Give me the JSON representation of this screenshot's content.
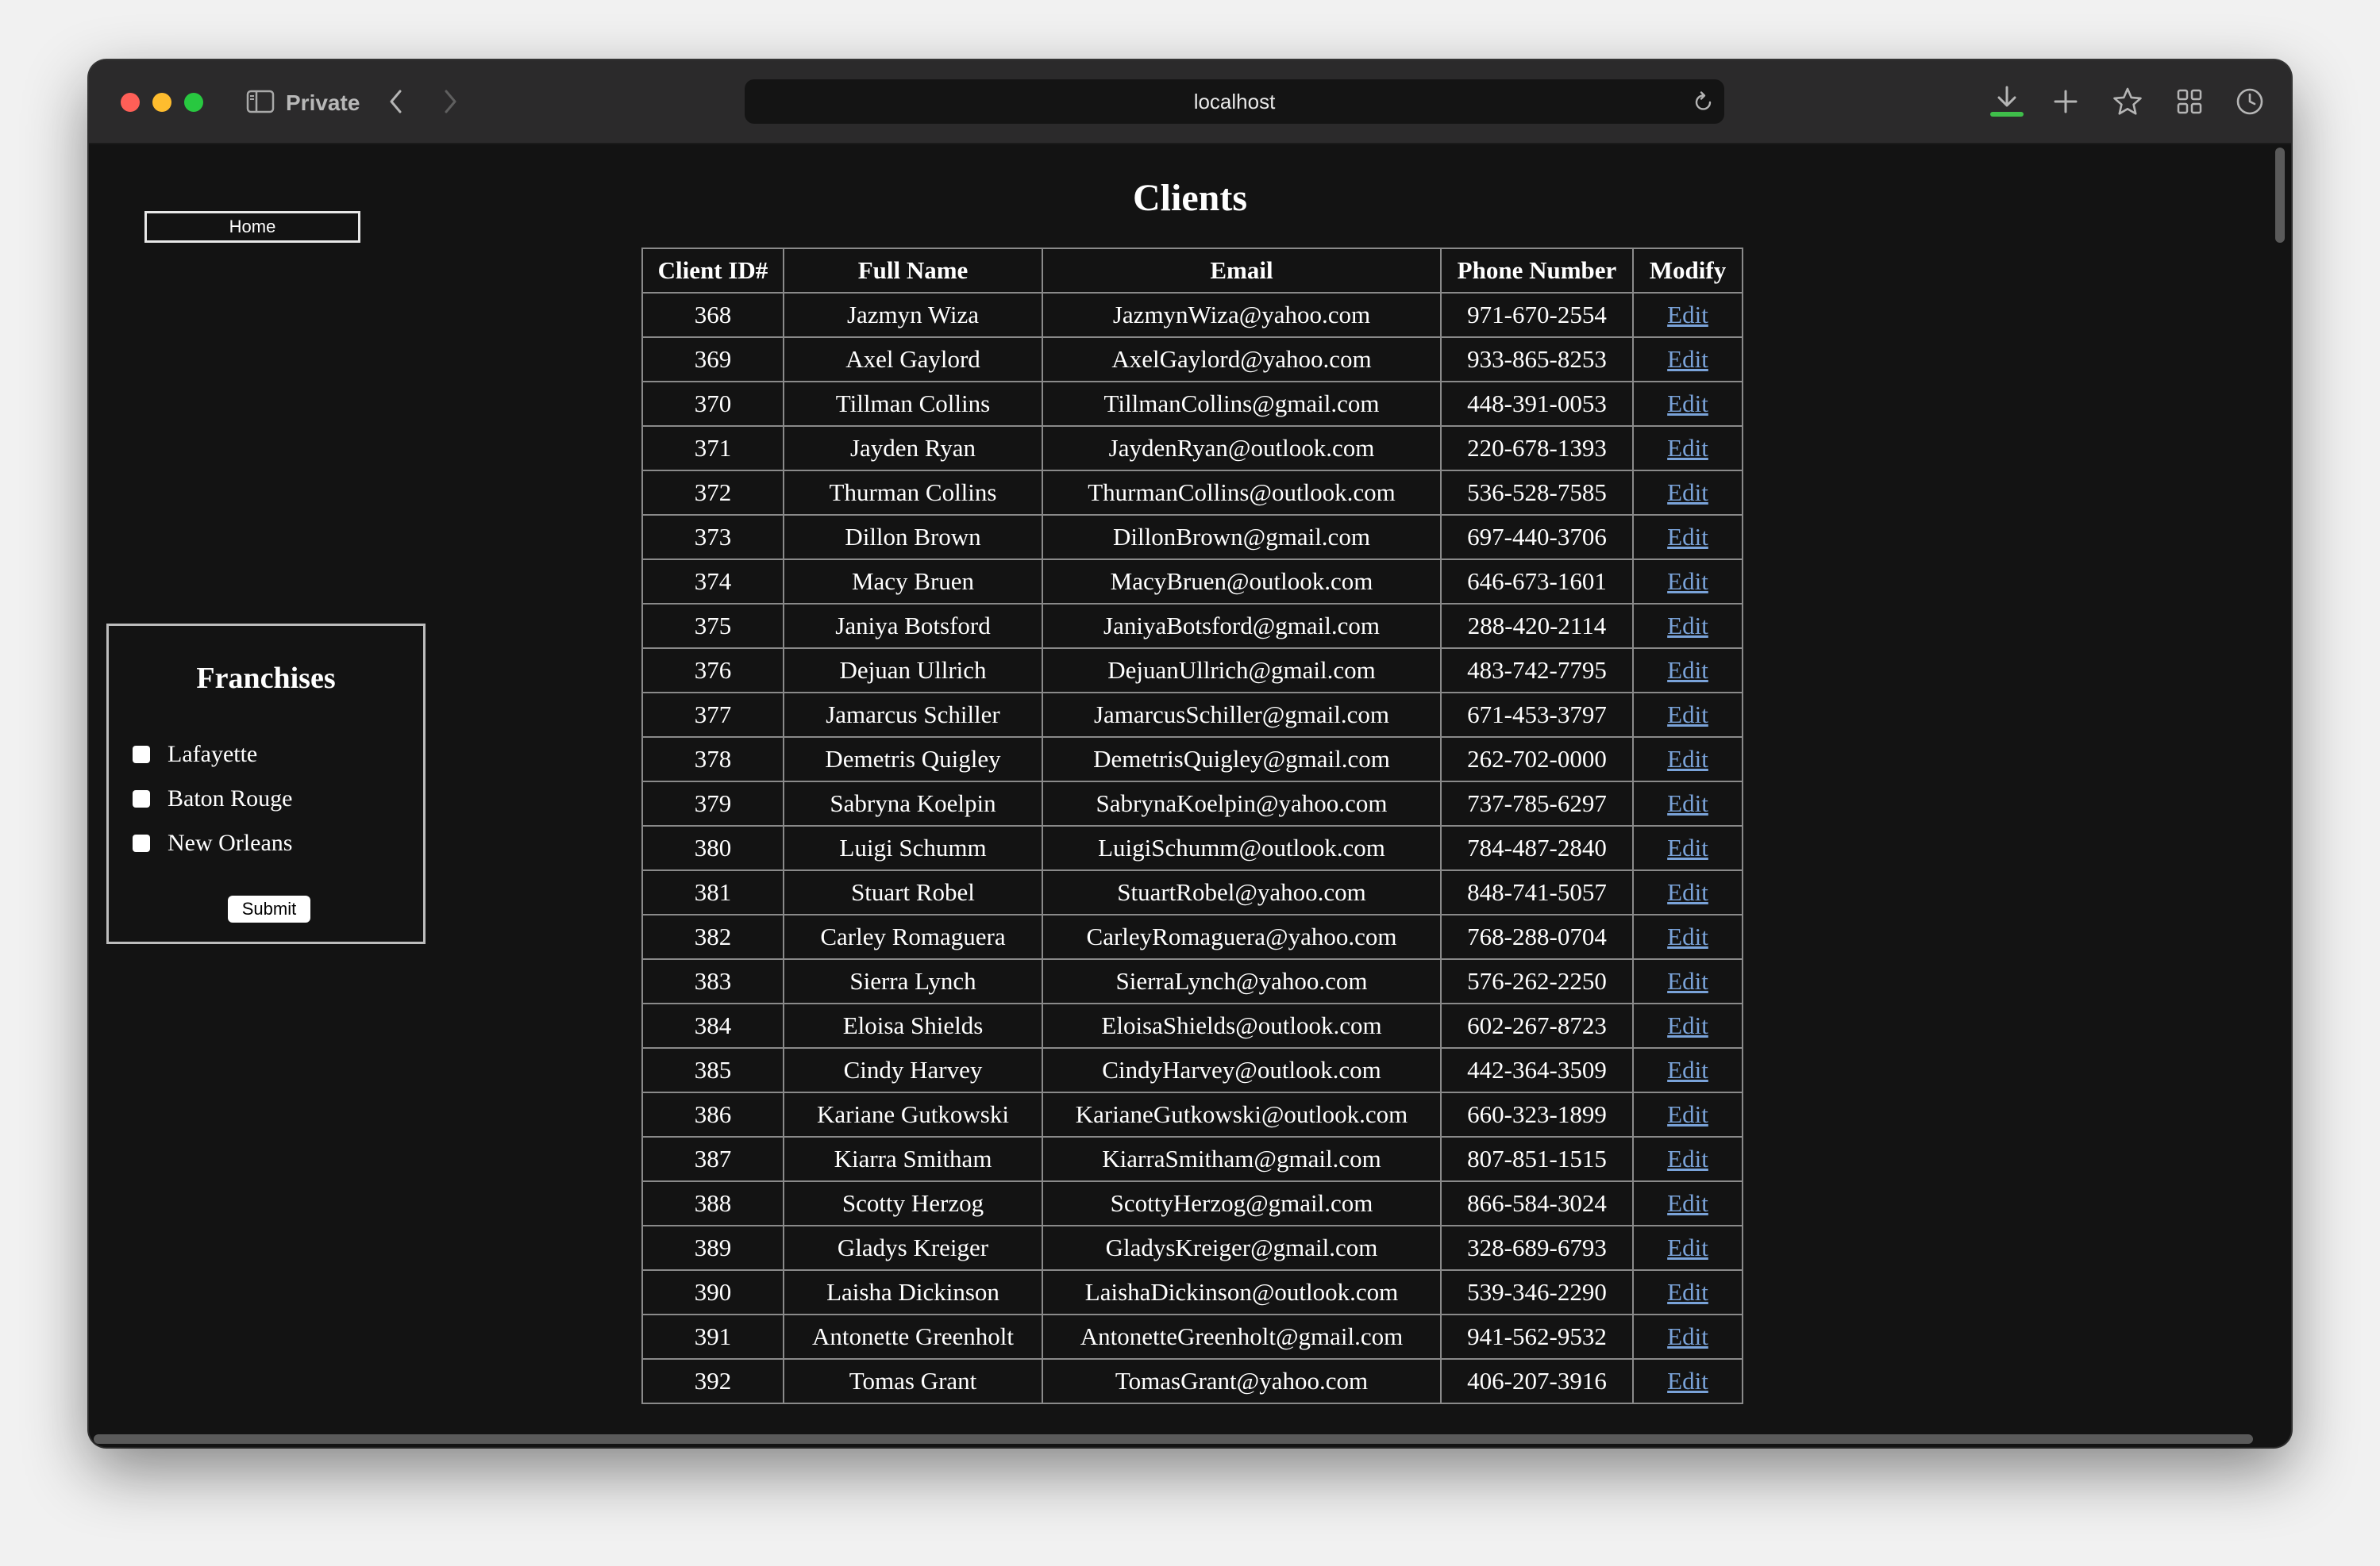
{
  "browser": {
    "mode_label": "Private",
    "url": "localhost"
  },
  "nav": {
    "home_label": "Home"
  },
  "franchises": {
    "title": "Franchises",
    "options": [
      {
        "label": "Lafayette",
        "checked": false
      },
      {
        "label": "Baton Rouge",
        "checked": false
      },
      {
        "label": "New Orleans",
        "checked": false
      }
    ],
    "submit_label": "Submit"
  },
  "page": {
    "title": "Clients"
  },
  "table": {
    "headers": [
      "Client ID#",
      "Full Name",
      "Email",
      "Phone Number",
      "Modify"
    ],
    "edit_label": "Edit",
    "link_color": "#7aa3d9",
    "rows": [
      {
        "id": "368",
        "name": "Jazmyn Wiza",
        "email": "JazmynWiza@yahoo.com",
        "phone": "971-670-2554"
      },
      {
        "id": "369",
        "name": "Axel Gaylord",
        "email": "AxelGaylord@yahoo.com",
        "phone": "933-865-8253"
      },
      {
        "id": "370",
        "name": "Tillman Collins",
        "email": "TillmanCollins@gmail.com",
        "phone": "448-391-0053"
      },
      {
        "id": "371",
        "name": "Jayden Ryan",
        "email": "JaydenRyan@outlook.com",
        "phone": "220-678-1393"
      },
      {
        "id": "372",
        "name": "Thurman Collins",
        "email": "ThurmanCollins@outlook.com",
        "phone": "536-528-7585"
      },
      {
        "id": "373",
        "name": "Dillon Brown",
        "email": "DillonBrown@gmail.com",
        "phone": "697-440-3706"
      },
      {
        "id": "374",
        "name": "Macy Bruen",
        "email": "MacyBruen@outlook.com",
        "phone": "646-673-1601"
      },
      {
        "id": "375",
        "name": "Janiya Botsford",
        "email": "JaniyaBotsford@gmail.com",
        "phone": "288-420-2114"
      },
      {
        "id": "376",
        "name": "Dejuan Ullrich",
        "email": "DejuanUllrich@gmail.com",
        "phone": "483-742-7795"
      },
      {
        "id": "377",
        "name": "Jamarcus Schiller",
        "email": "JamarcusSchiller@gmail.com",
        "phone": "671-453-3797"
      },
      {
        "id": "378",
        "name": "Demetris Quigley",
        "email": "DemetrisQuigley@gmail.com",
        "phone": "262-702-0000"
      },
      {
        "id": "379",
        "name": "Sabryna Koelpin",
        "email": "SabrynaKoelpin@yahoo.com",
        "phone": "737-785-6297"
      },
      {
        "id": "380",
        "name": "Luigi Schumm",
        "email": "LuigiSchumm@outlook.com",
        "phone": "784-487-2840"
      },
      {
        "id": "381",
        "name": "Stuart Robel",
        "email": "StuartRobel@yahoo.com",
        "phone": "848-741-5057"
      },
      {
        "id": "382",
        "name": "Carley Romaguera",
        "email": "CarleyRomaguera@yahoo.com",
        "phone": "768-288-0704"
      },
      {
        "id": "383",
        "name": "Sierra Lynch",
        "email": "SierraLynch@yahoo.com",
        "phone": "576-262-2250"
      },
      {
        "id": "384",
        "name": "Eloisa Shields",
        "email": "EloisaShields@outlook.com",
        "phone": "602-267-8723"
      },
      {
        "id": "385",
        "name": "Cindy Harvey",
        "email": "CindyHarvey@outlook.com",
        "phone": "442-364-3509"
      },
      {
        "id": "386",
        "name": "Kariane Gutkowski",
        "email": "KarianeGutkowski@outlook.com",
        "phone": "660-323-1899"
      },
      {
        "id": "387",
        "name": "Kiarra Smitham",
        "email": "KiarraSmitham@gmail.com",
        "phone": "807-851-1515"
      },
      {
        "id": "388",
        "name": "Scotty Herzog",
        "email": "ScottyHerzog@gmail.com",
        "phone": "866-584-3024"
      },
      {
        "id": "389",
        "name": "Gladys Kreiger",
        "email": "GladysKreiger@gmail.com",
        "phone": "328-689-6793"
      },
      {
        "id": "390",
        "name": "Laisha Dickinson",
        "email": "LaishaDickinson@outlook.com",
        "phone": "539-346-2290"
      },
      {
        "id": "391",
        "name": "Antonette Greenholt",
        "email": "AntonetteGreenholt@gmail.com",
        "phone": "941-562-9532"
      },
      {
        "id": "392",
        "name": "Tomas Grant",
        "email": "TomasGrant@yahoo.com",
        "phone": "406-207-3916"
      }
    ]
  },
  "icons": {
    "close": "close-window-icon",
    "minimize": "minimize-window-icon",
    "maximize": "maximize-window-icon",
    "sidebar": "sidebar-icon",
    "back": "chevron-left-icon",
    "forward": "chevron-right-icon",
    "reload": "reload-icon",
    "download": "download-icon",
    "new_tab": "plus-icon",
    "bookmark": "star-icon",
    "tabs_overview": "grid-icon",
    "history": "clock-icon"
  },
  "colors": {
    "page_bg": "#131313",
    "toolbar_bg": "#2b2a2b",
    "close": "#fe5f57",
    "minimize": "#febc2e",
    "maximize": "#28c840",
    "download_accent": "#3fbe4a"
  }
}
